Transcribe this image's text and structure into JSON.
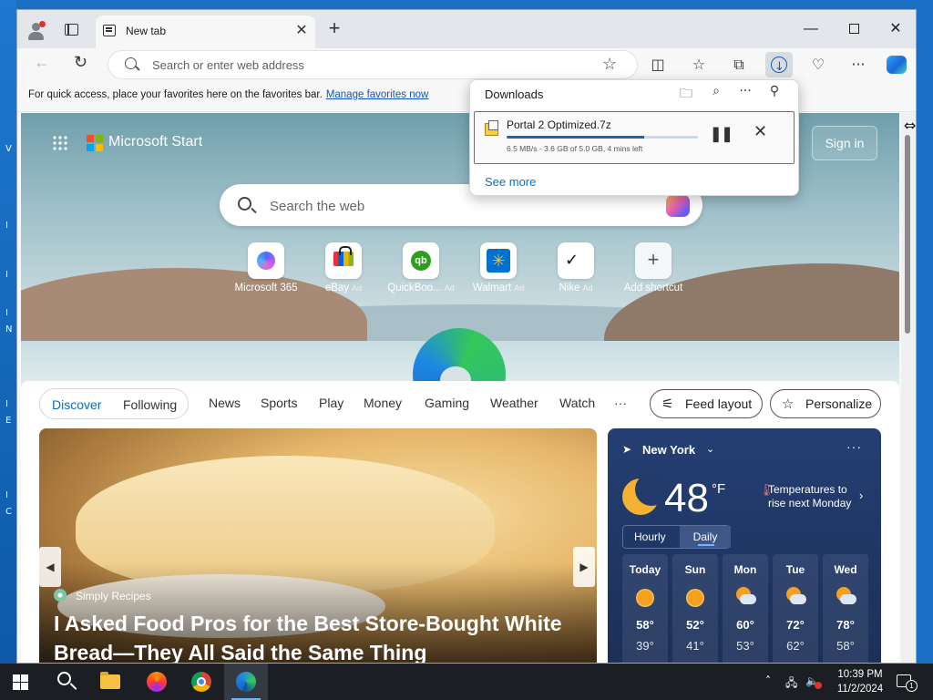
{
  "desktop": {
    "side_letters": [
      "V",
      "I",
      "I",
      "I",
      "N",
      "I",
      "E",
      "I",
      "C"
    ]
  },
  "browser": {
    "tab": {
      "title": "New tab"
    },
    "window_controls": {
      "minimize": "—",
      "close": "✕"
    },
    "toolbar": {
      "address_placeholder": "Search or enter web address",
      "icons": [
        "back-icon",
        "refresh-icon",
        "favorite-star-icon",
        "split-screen-icon",
        "favorites-icon",
        "collections-icon",
        "downloads-icon",
        "browser-essentials-icon",
        "more-icon",
        "copilot-icon"
      ]
    },
    "favorites_bar": {
      "text": "For quick access, place your favorites here on the favorites bar.",
      "link": "Manage favorites now"
    },
    "downloads_panel": {
      "title": "Downloads",
      "item": {
        "filename": "Portal 2 Optimized.7z",
        "progress": 0.72,
        "status": "6.5 MB/s - 3.6 GB of 5.0 GB, 4 mins left"
      },
      "see_more": "See more"
    }
  },
  "start_page": {
    "brand": "Microsoft Start",
    "sign_in": "Sign in",
    "search_placeholder": "Search the web",
    "shortcuts": [
      {
        "label": "Microsoft 365",
        "ad": ""
      },
      {
        "label": "eBay",
        "ad": "Ad"
      },
      {
        "label": "QuickBoo...",
        "ad": "Ad"
      },
      {
        "label": "Walmart",
        "ad": "Ad"
      },
      {
        "label": "Nike",
        "ad": "Ad"
      },
      {
        "label": "Add shortcut",
        "ad": ""
      }
    ],
    "feed_nav": {
      "discover": "Discover",
      "following": "Following",
      "items": [
        "News",
        "Sports",
        "Play",
        "Money",
        "Gaming",
        "Weather",
        "Watch",
        "···"
      ],
      "feed_layout": "Feed layout",
      "personalize": "Personalize"
    },
    "hero": {
      "source": "Simply Recipes",
      "title": "I Asked Food Pros for the Best Store-Bought White Bread—They All Said the Same Thing"
    },
    "weather": {
      "location": "New York",
      "temp": "48",
      "unit": "°F",
      "alert": "Temperatures to rise next Monday",
      "hourly": "Hourly",
      "daily": "Daily",
      "days": [
        {
          "name": "Today",
          "hi": "58°",
          "lo": "39°",
          "icon": "sunny-icon"
        },
        {
          "name": "Sun",
          "hi": "52°",
          "lo": "41°",
          "icon": "sunny-icon"
        },
        {
          "name": "Mon",
          "hi": "60°",
          "lo": "53°",
          "icon": "partly-cloudy-icon"
        },
        {
          "name": "Tue",
          "hi": "72°",
          "lo": "62°",
          "icon": "partly-cloudy-icon"
        },
        {
          "name": "Wed",
          "hi": "78°",
          "lo": "58°",
          "icon": "partly-cloudy-icon"
        }
      ]
    }
  },
  "taskbar": {
    "time": "10:39 PM",
    "date": "11/2/2024",
    "notification_count": "1"
  }
}
